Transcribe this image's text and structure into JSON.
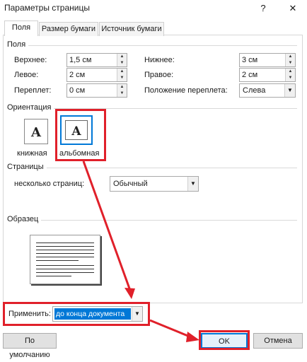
{
  "window": {
    "title": "Параметры страницы",
    "help_label": "?",
    "close_label": "✕"
  },
  "tabs": [
    {
      "label": "Поля",
      "active": true
    },
    {
      "label": "Размер бумаги",
      "active": false
    },
    {
      "label": "Источник бумаги",
      "active": false
    }
  ],
  "margins": {
    "group_title": "Поля",
    "top": {
      "label": "Верхнее:",
      "value": "1,5 см"
    },
    "bottom": {
      "label": "Нижнее:",
      "value": "3 см"
    },
    "left": {
      "label": "Левое:",
      "value": "2 см"
    },
    "right": {
      "label": "Правое:",
      "value": "2 см"
    },
    "gutter": {
      "label": "Переплет:",
      "value": "0 см"
    },
    "gutter_position": {
      "label": "Положение переплета:",
      "value": "Слева"
    }
  },
  "orientation": {
    "group_title": "Ориентация",
    "portrait_label": "книжная",
    "landscape_label": "альбомная",
    "icon_letter": "A",
    "selected": "landscape"
  },
  "pages": {
    "group_title": "Страницы",
    "multiple_label": "несколько страниц:",
    "multiple_value": "Обычный"
  },
  "preview": {
    "group_title": "Образец"
  },
  "apply": {
    "label": "Применить:",
    "value": "до конца документа"
  },
  "buttons": {
    "default": "По умолчанию",
    "ok": "OK",
    "cancel": "Отмена"
  },
  "colors": {
    "annotation": "#e0202a",
    "selection": "#0078d7"
  }
}
